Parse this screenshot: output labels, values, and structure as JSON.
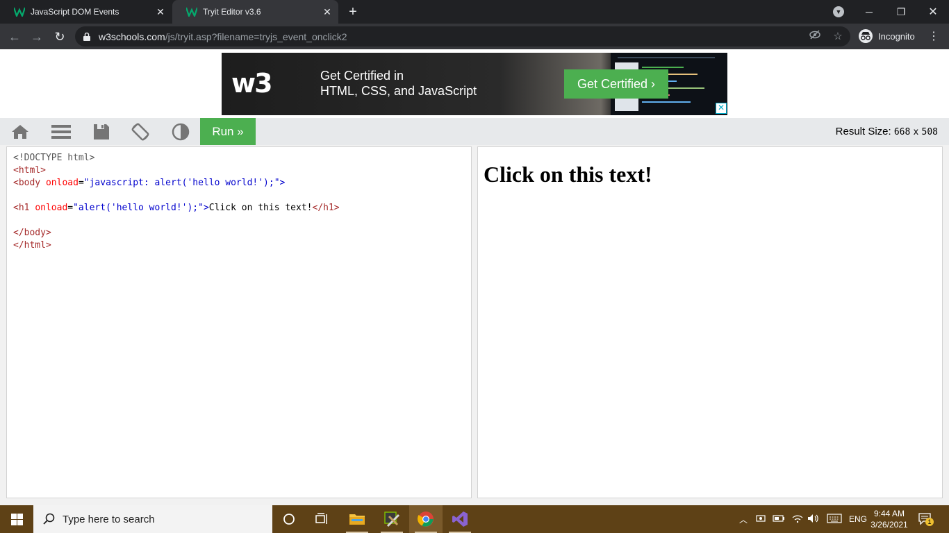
{
  "browser": {
    "tabs": [
      {
        "title": "JavaScript DOM Events",
        "favicon": "w3schools-favicon",
        "active": false
      },
      {
        "title": "Tryit Editor v3.6",
        "favicon": "w3schools-favicon",
        "active": true
      }
    ],
    "url_host": "w3schools.com",
    "url_path": "/js/tryit.asp?filename=tryjs_event_onclick2",
    "profile_label": "Incognito"
  },
  "ad": {
    "logo": "w3",
    "line1": "Get Certified in",
    "line2": "HTML, CSS, and JavaScript",
    "button": "Get Certified ›",
    "close": "✕"
  },
  "toolbar": {
    "run_label": "Run »",
    "result_size_label": "Result Size:",
    "result_width": "668",
    "result_x": "x",
    "result_height": "508"
  },
  "code": {
    "line1": "<!DOCTYPE html>",
    "line2_tag": "<html>",
    "line3_open": "<body",
    "line3_attr": "onload",
    "line3_eq": "=",
    "line3_val": "\"javascript: alert('hello world!');\"",
    "line3_close": ">",
    "line5_open": "<h1",
    "line5_attr": "onload",
    "line5_eq": "=",
    "line5_val": "\"alert('hello world!');\"",
    "line5_gt": ">",
    "line5_text": "Click on this text!",
    "line5_end": "</h1>",
    "line7": "</body>",
    "line8": "</html>"
  },
  "result": {
    "heading": "Click on this text!"
  },
  "taskbar": {
    "search_placeholder": "Type here to search",
    "language": "ENG",
    "time": "9:44 AM",
    "date": "3/26/2021",
    "notification_count": "1"
  },
  "colors": {
    "run_green": "#4caf50",
    "taskbar_brown": "#5e4116",
    "chrome_dark": "#202124"
  }
}
